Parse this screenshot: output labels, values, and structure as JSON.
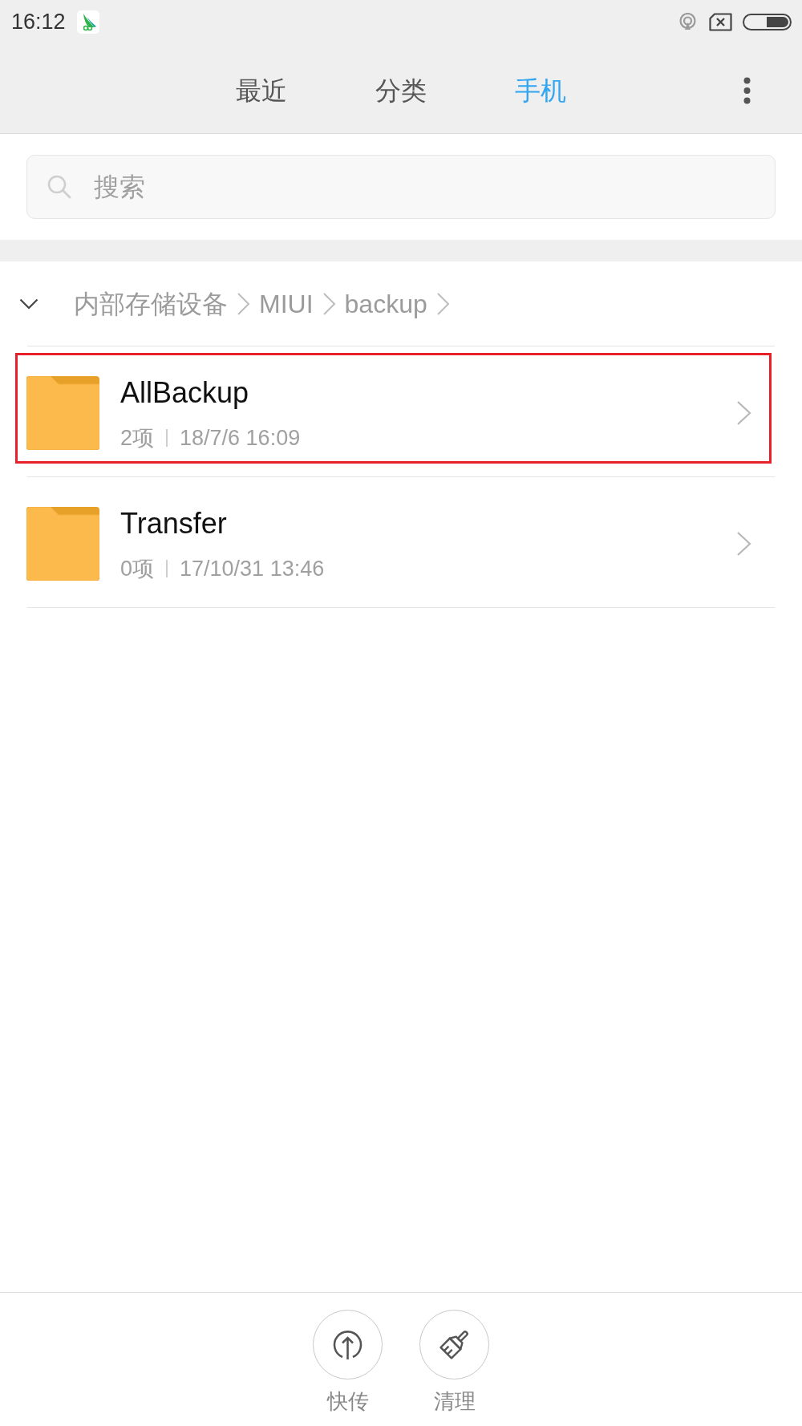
{
  "status_bar": {
    "time": "16:12"
  },
  "tabs": [
    {
      "label": "最近",
      "selected": false
    },
    {
      "label": "分类",
      "selected": false
    },
    {
      "label": "手机",
      "selected": true
    }
  ],
  "search": {
    "placeholder": "搜索"
  },
  "breadcrumb": [
    "内部存储设备",
    "MIUI",
    "backup"
  ],
  "folders": [
    {
      "name": "AllBackup",
      "count": "2项",
      "modified": "18/7/6 16:09",
      "highlighted": true
    },
    {
      "name": "Transfer",
      "count": "0项",
      "modified": "17/10/31 13:46",
      "highlighted": false
    }
  ],
  "bottom_actions": [
    {
      "label": "快传",
      "kind": "transfer"
    },
    {
      "label": "清理",
      "kind": "clean"
    }
  ]
}
